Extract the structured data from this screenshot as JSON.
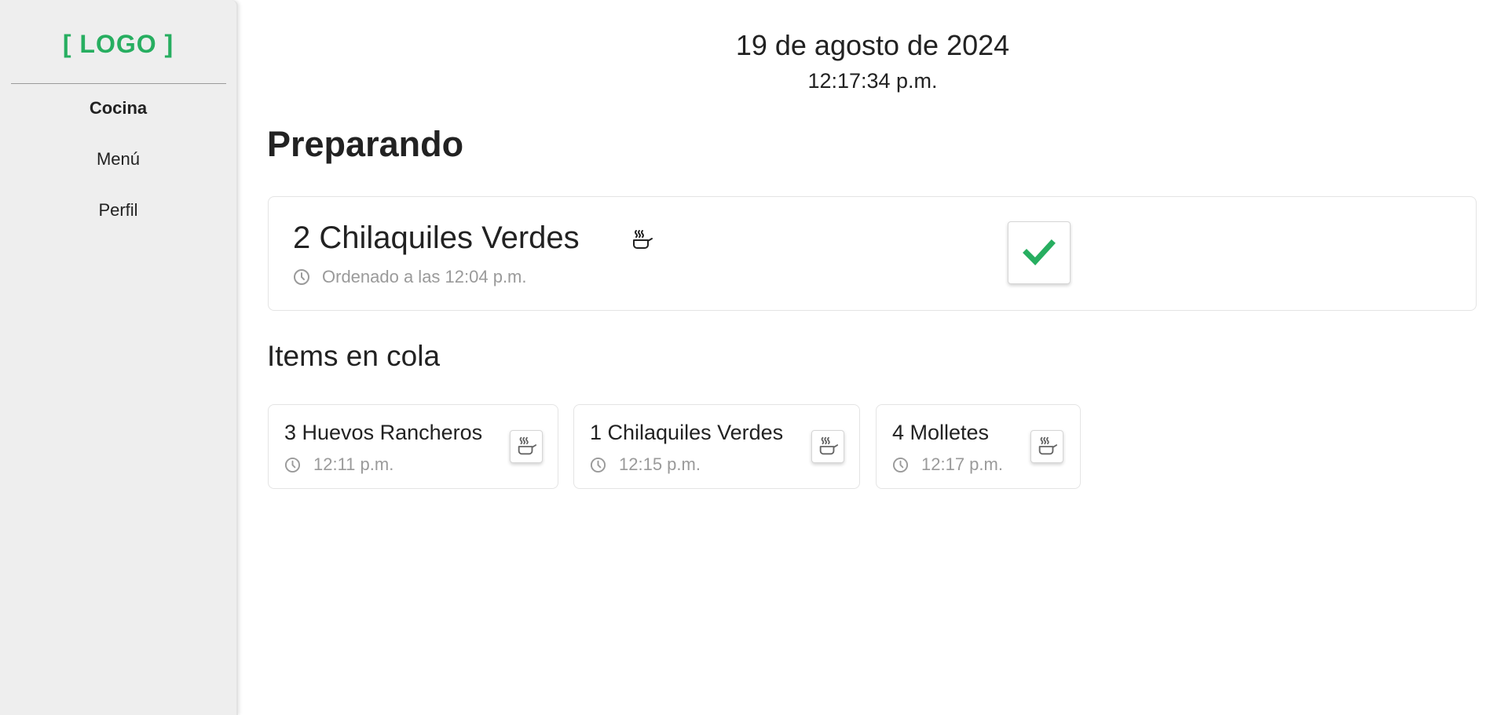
{
  "sidebar": {
    "logo": "[ LOGO ]",
    "logo_color": "#27ae60",
    "items": [
      {
        "label": "Cocina",
        "active": true
      },
      {
        "label": "Menú",
        "active": false
      },
      {
        "label": "Perfil",
        "active": false
      }
    ]
  },
  "header": {
    "date": "19 de agosto de 2024",
    "time": "12:17:34 p.m."
  },
  "preparing": {
    "title": "Preparando",
    "item": {
      "name": "2 Chilaquiles Verdes",
      "ordered_at": "Ordenado a las 12:04 p.m.",
      "status_icon": "cooking-pot-icon",
      "action_icon": "check-icon",
      "action_color": "#27ae60"
    }
  },
  "queue": {
    "title": "Items en cola",
    "items": [
      {
        "name": "3 Huevos Rancheros",
        "time": "12:11 p.m.",
        "action_icon": "cooking-pot-icon"
      },
      {
        "name": "1 Chilaquiles Verdes",
        "time": "12:15 p.m.",
        "action_icon": "cooking-pot-icon"
      },
      {
        "name": "4 Molletes",
        "time": "12:17 p.m.",
        "action_icon": "cooking-pot-icon"
      }
    ]
  }
}
